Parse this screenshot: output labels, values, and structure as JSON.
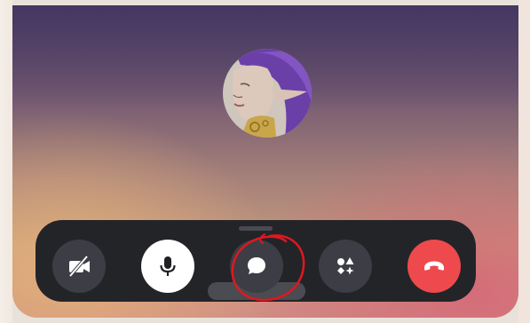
{
  "call": {
    "participant_avatar_icon": "elf-portrait-avatar",
    "tooltip_text": ""
  },
  "controls": [
    {
      "name": "camera-toggle-button",
      "icon": "video-off-icon",
      "state": "off"
    },
    {
      "name": "microphone-button",
      "icon": "microphone-icon",
      "state": "on"
    },
    {
      "name": "chat-button",
      "icon": "chat-bubble-icon",
      "state": "highlighted"
    },
    {
      "name": "activities-button",
      "icon": "activities-icon",
      "state": "default"
    },
    {
      "name": "end-call-button",
      "icon": "hang-up-icon",
      "state": "default"
    }
  ],
  "colors": {
    "bar": "#232428",
    "button": "#3d3e45",
    "mic_button": "#ffffff",
    "end_call": "#ee4a4d",
    "annotation": "#e0181e"
  }
}
